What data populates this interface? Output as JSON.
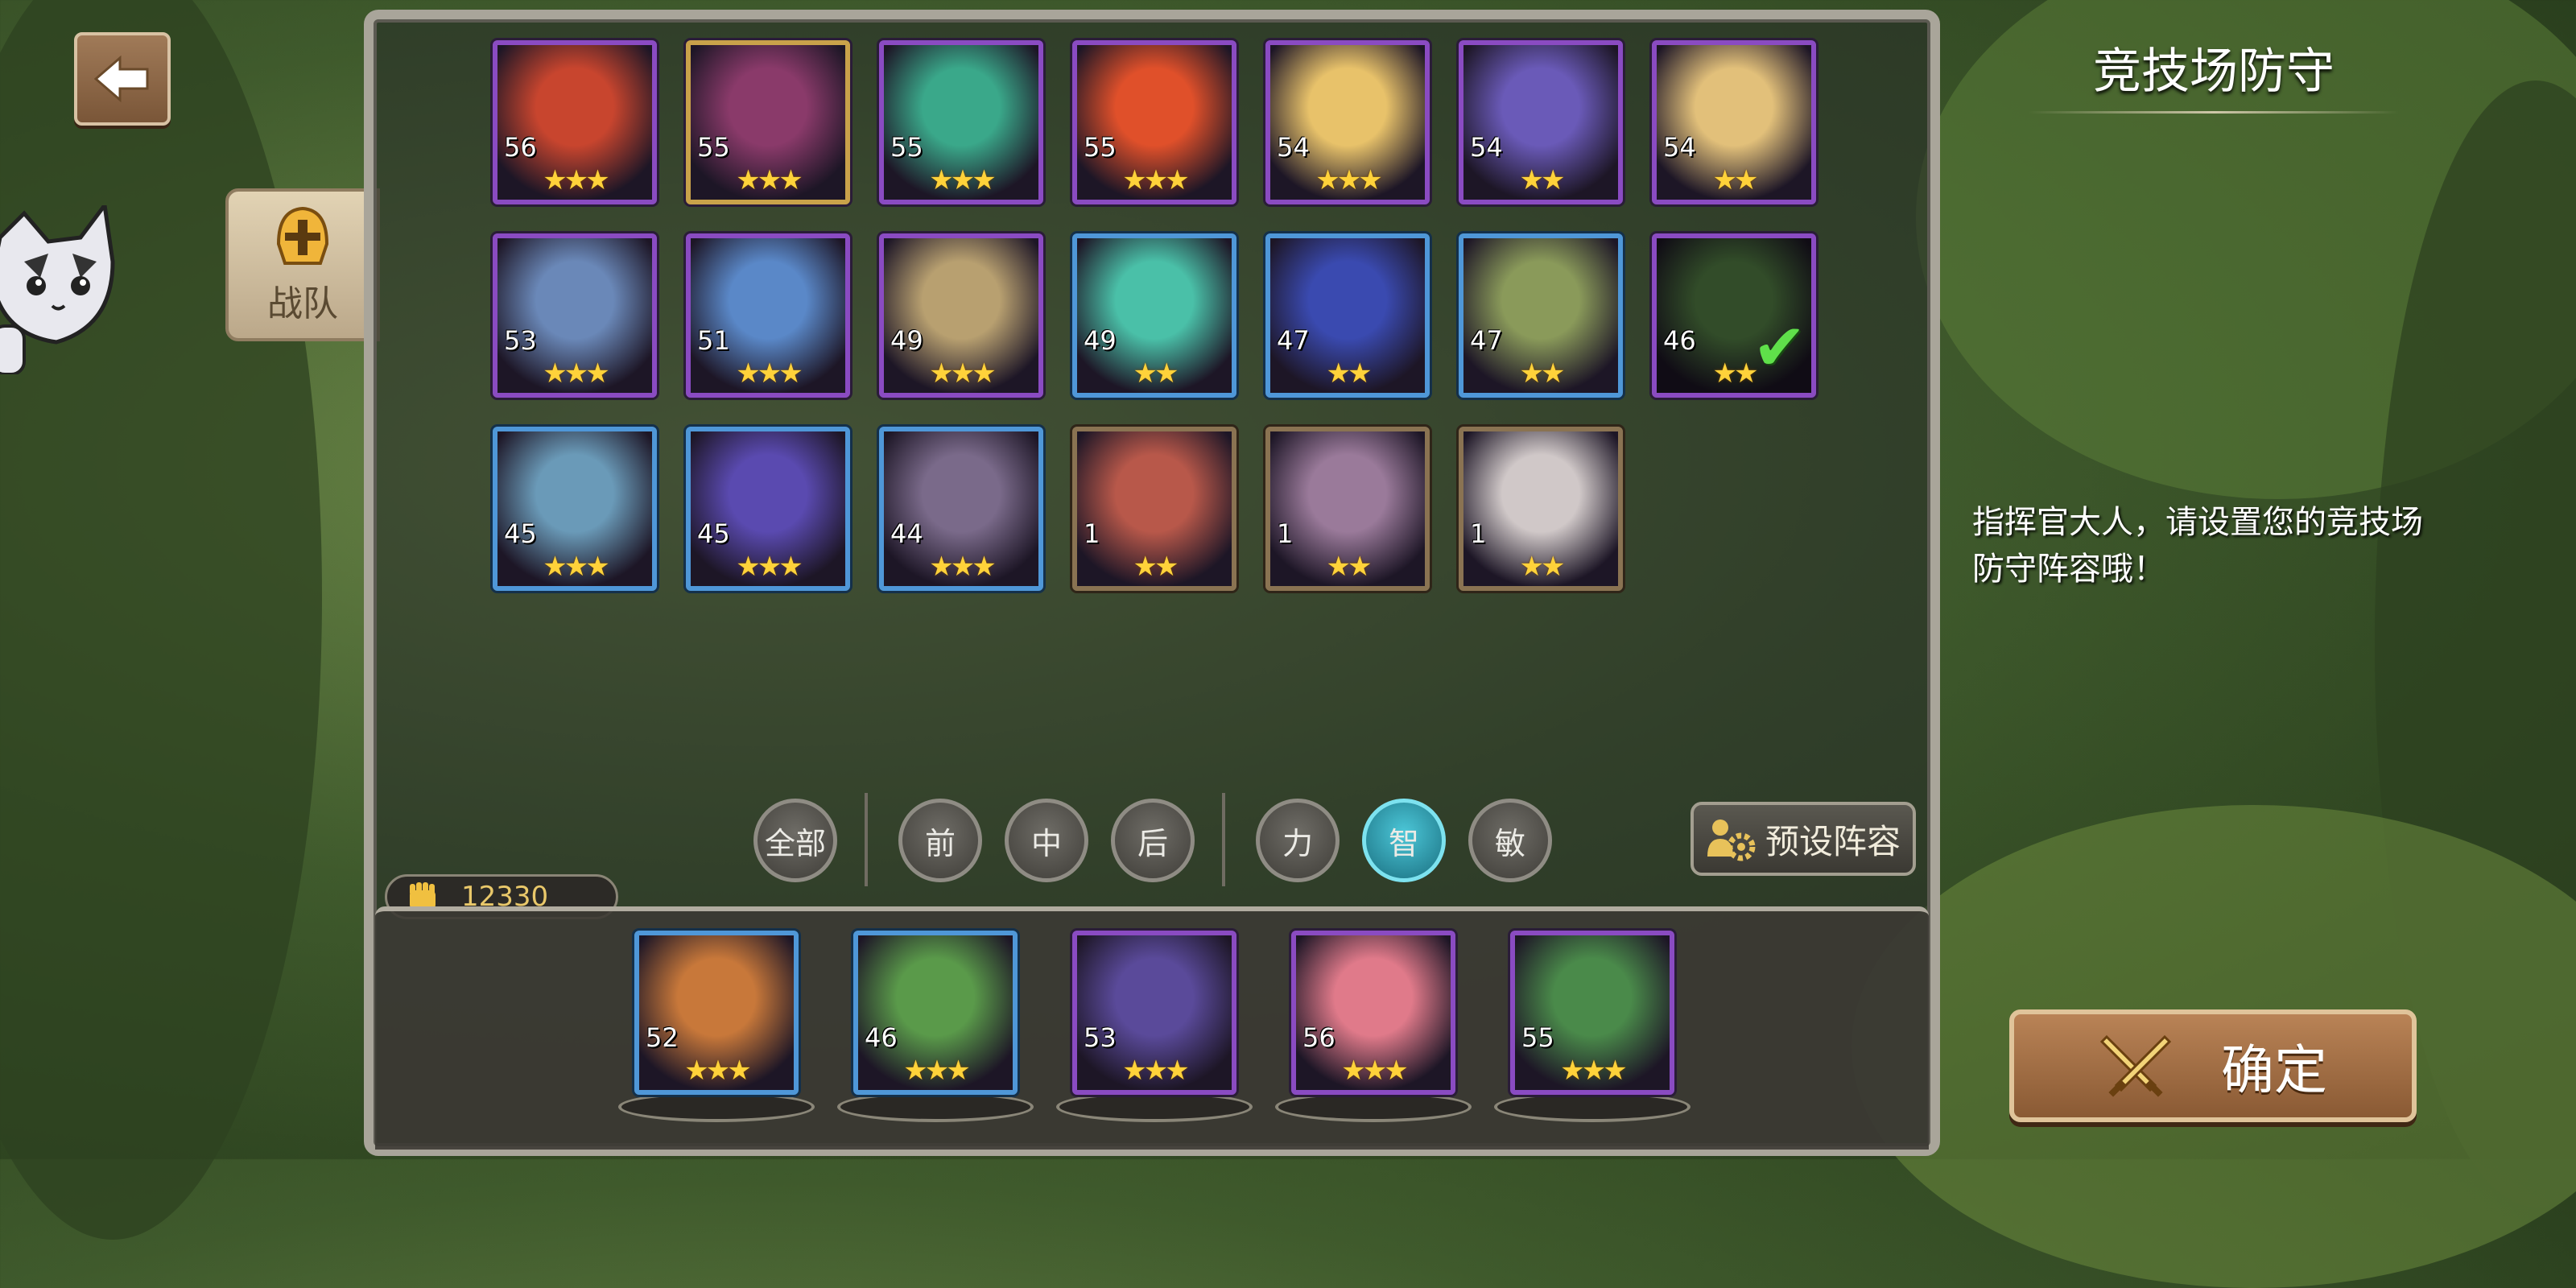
{
  "side_panel": {
    "title": "竞技场防守",
    "description": "指挥官大人，请设置您的竞技场防守阵容哦！"
  },
  "team_tab": {
    "label": "战队"
  },
  "filters": {
    "all": "全部",
    "front": "前",
    "middle": "中",
    "back": "后",
    "strength": "力",
    "intelligence": "智",
    "agility": "敏",
    "active": "智"
  },
  "preset_button": {
    "label": "预设阵容"
  },
  "power": {
    "value": "12330"
  },
  "confirm_button": {
    "label": "确定"
  },
  "hero_roster": [
    {
      "level": "56",
      "stars": 3,
      "frame": "purple",
      "color": "#c8452e"
    },
    {
      "level": "55",
      "stars": 3,
      "frame": "gold",
      "color": "#8a3a6a"
    },
    {
      "level": "55",
      "stars": 3,
      "frame": "purple",
      "color": "#3aa88a"
    },
    {
      "level": "55",
      "stars": 3,
      "frame": "purple",
      "color": "#e0502a"
    },
    {
      "level": "54",
      "stars": 3,
      "frame": "purple",
      "color": "#e8c26a"
    },
    {
      "level": "54",
      "stars": 2,
      "frame": "purple",
      "color": "#6a5ab8"
    },
    {
      "level": "54",
      "stars": 2,
      "frame": "purple",
      "color": "#e2c07a"
    },
    {
      "level": "53",
      "stars": 3,
      "frame": "purple",
      "color": "#6a88b8"
    },
    {
      "level": "51",
      "stars": 3,
      "frame": "purple",
      "color": "#5a88c8"
    },
    {
      "level": "49",
      "stars": 3,
      "frame": "purple",
      "color": "#b8a070"
    },
    {
      "level": "49",
      "stars": 2,
      "frame": "blue",
      "color": "#4ac0a8"
    },
    {
      "level": "47",
      "stars": 2,
      "frame": "blue",
      "color": "#3a4ab0"
    },
    {
      "level": "47",
      "stars": 2,
      "frame": "blue",
      "color": "#8a9a5a"
    },
    {
      "level": "46",
      "stars": 2,
      "frame": "purple",
      "color": "#5a8a4a",
      "selected": true
    },
    {
      "level": "45",
      "stars": 3,
      "frame": "blue",
      "color": "#6a9ab8"
    },
    {
      "level": "45",
      "stars": 3,
      "frame": "blue",
      "color": "#5a4ab0"
    },
    {
      "level": "44",
      "stars": 3,
      "frame": "blue",
      "color": "#7a6a8a"
    },
    {
      "level": "1",
      "stars": 2,
      "frame": "brown",
      "color": "#b8584a"
    },
    {
      "level": "1",
      "stars": 2,
      "frame": "brown",
      "color": "#9a7a9a"
    },
    {
      "level": "1",
      "stars": 2,
      "frame": "brown",
      "color": "#d0c8c8"
    }
  ],
  "selected_team": [
    {
      "level": "52",
      "stars": 3,
      "frame": "blue",
      "color": "#c8783a"
    },
    {
      "level": "46",
      "stars": 3,
      "frame": "blue",
      "color": "#5a9a4a"
    },
    {
      "level": "53",
      "stars": 3,
      "frame": "purple",
      "color": "#5a4a9a"
    },
    {
      "level": "56",
      "stars": 3,
      "frame": "purple",
      "color": "#e07a8a"
    },
    {
      "level": "55",
      "stars": 3,
      "frame": "purple",
      "color": "#4a8a4a"
    }
  ]
}
